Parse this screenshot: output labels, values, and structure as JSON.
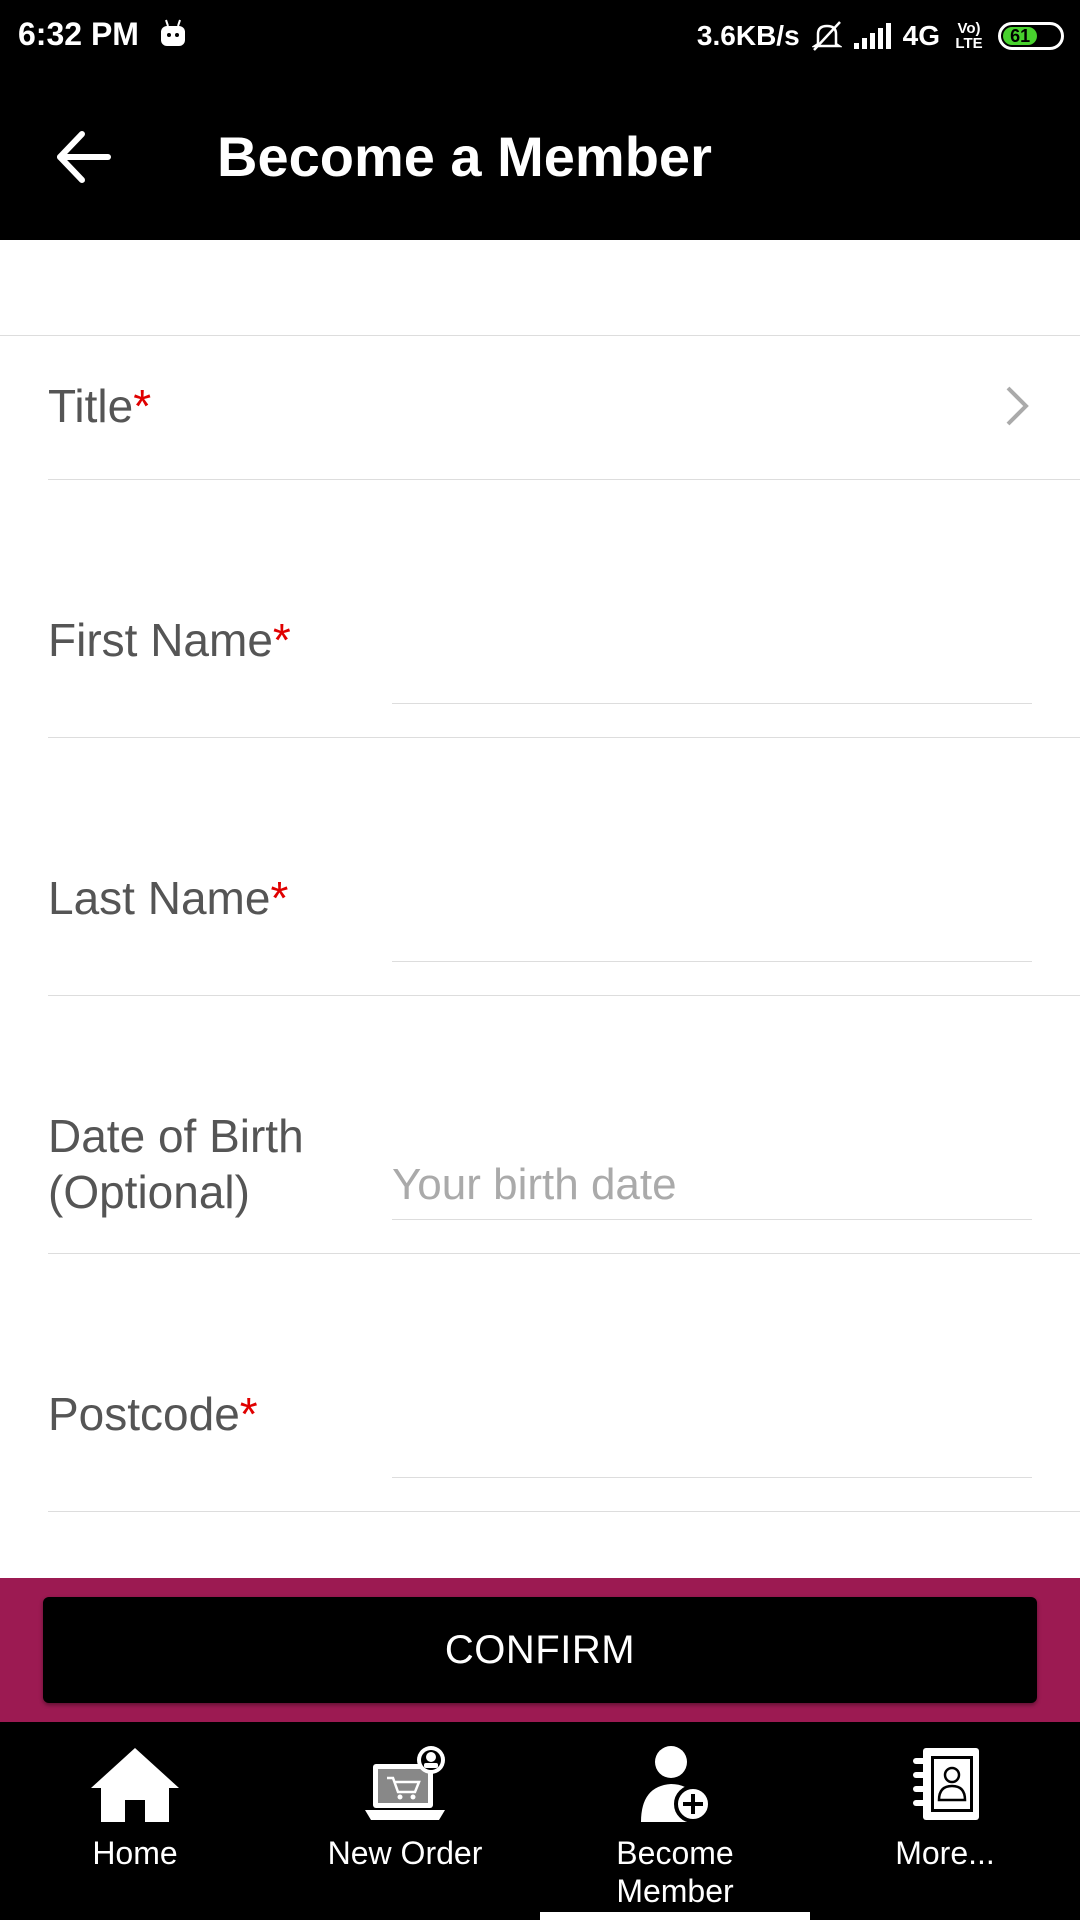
{
  "status_bar": {
    "time": "6:32 PM",
    "network_speed": "3.6KB/s",
    "network_type": "4G",
    "volte": "Vo) LTE",
    "battery": "61"
  },
  "app_bar": {
    "title": "Become a Member",
    "back_icon": "arrow-left-icon"
  },
  "form": {
    "fields": [
      {
        "label": "Title",
        "required": "*",
        "value": "",
        "placeholder": ""
      },
      {
        "label": "First Name",
        "required": "*",
        "value": "",
        "placeholder": ""
      },
      {
        "label": "Last Name",
        "required": "*",
        "value": "",
        "placeholder": ""
      },
      {
        "label_line1": "Date of Birth",
        "label_line2": "(Optional)",
        "value": "",
        "placeholder": "Your birth date"
      },
      {
        "label": "Postcode",
        "required": "*",
        "value": "",
        "placeholder": ""
      }
    ]
  },
  "confirm": {
    "label": "CONFIRM",
    "area_color": "#9c1a52"
  },
  "bottom_nav": {
    "items": [
      {
        "label": "Home",
        "icon": "home-icon"
      },
      {
        "label": "New Order",
        "icon": "laptop-cart-icon"
      },
      {
        "label_line1": "Become",
        "label_line2": "Member",
        "icon": "add-user-icon",
        "active": true
      },
      {
        "label": "More...",
        "icon": "contacts-book-icon"
      }
    ]
  }
}
